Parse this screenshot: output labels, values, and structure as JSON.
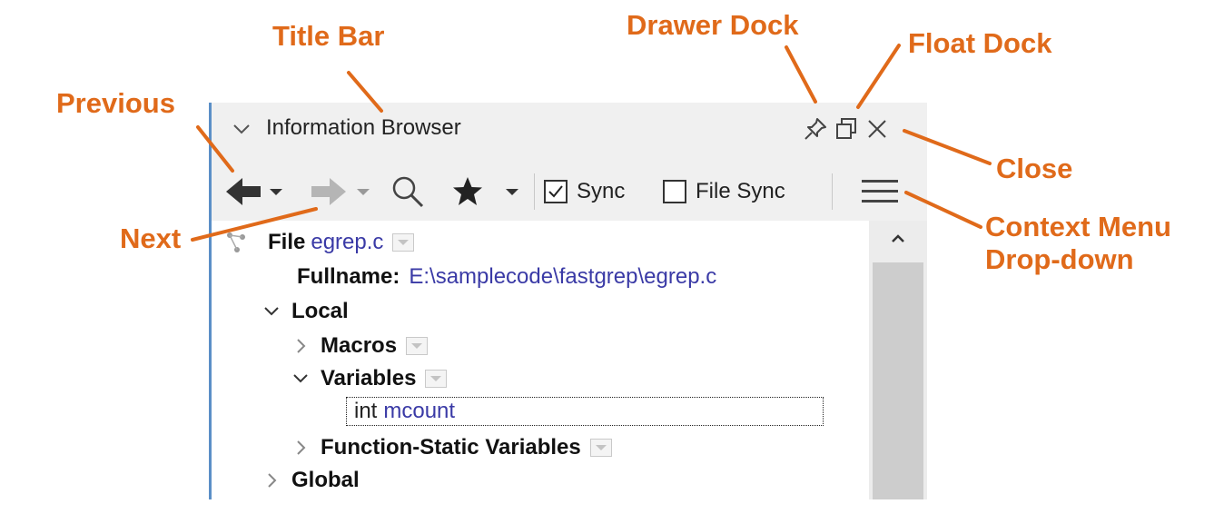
{
  "window": {
    "title": "Information Browser",
    "icons": [
      "chevron-down-icon",
      "pin-icon",
      "float-icon",
      "close-icon"
    ]
  },
  "toolbar": {
    "sync_label": "Sync",
    "sync_checked": true,
    "file_sync_label": "File Sync",
    "file_sync_checked": false,
    "icons": [
      "back-arrow-icon",
      "forward-arrow-icon",
      "search-icon",
      "star-icon",
      "hamburger-menu-icon"
    ]
  },
  "tree": {
    "file_label": "File",
    "file_name": "egrep.c",
    "fullname_label": "Fullname:",
    "fullname_value": "E:\\samplecode\\fastgrep\\egrep.c",
    "local_label": "Local",
    "macros_label": "Macros",
    "variables_label": "Variables",
    "var_type": "int",
    "var_name": "mcount",
    "func_static_label": "Function-Static Variables",
    "global_label": "Global"
  },
  "annotations": {
    "title_bar": "Title Bar",
    "drawer_dock": "Drawer Dock",
    "float_dock": "Float Dock",
    "previous": "Previous",
    "close": "Close",
    "next": "Next",
    "context_menu_line1": "Context Menu",
    "context_menu_line2": "Drop-down"
  },
  "colors": {
    "annotation": "#e06a1a",
    "link_value": "#3a3aa6",
    "panel_border": "#5b8fc7"
  }
}
